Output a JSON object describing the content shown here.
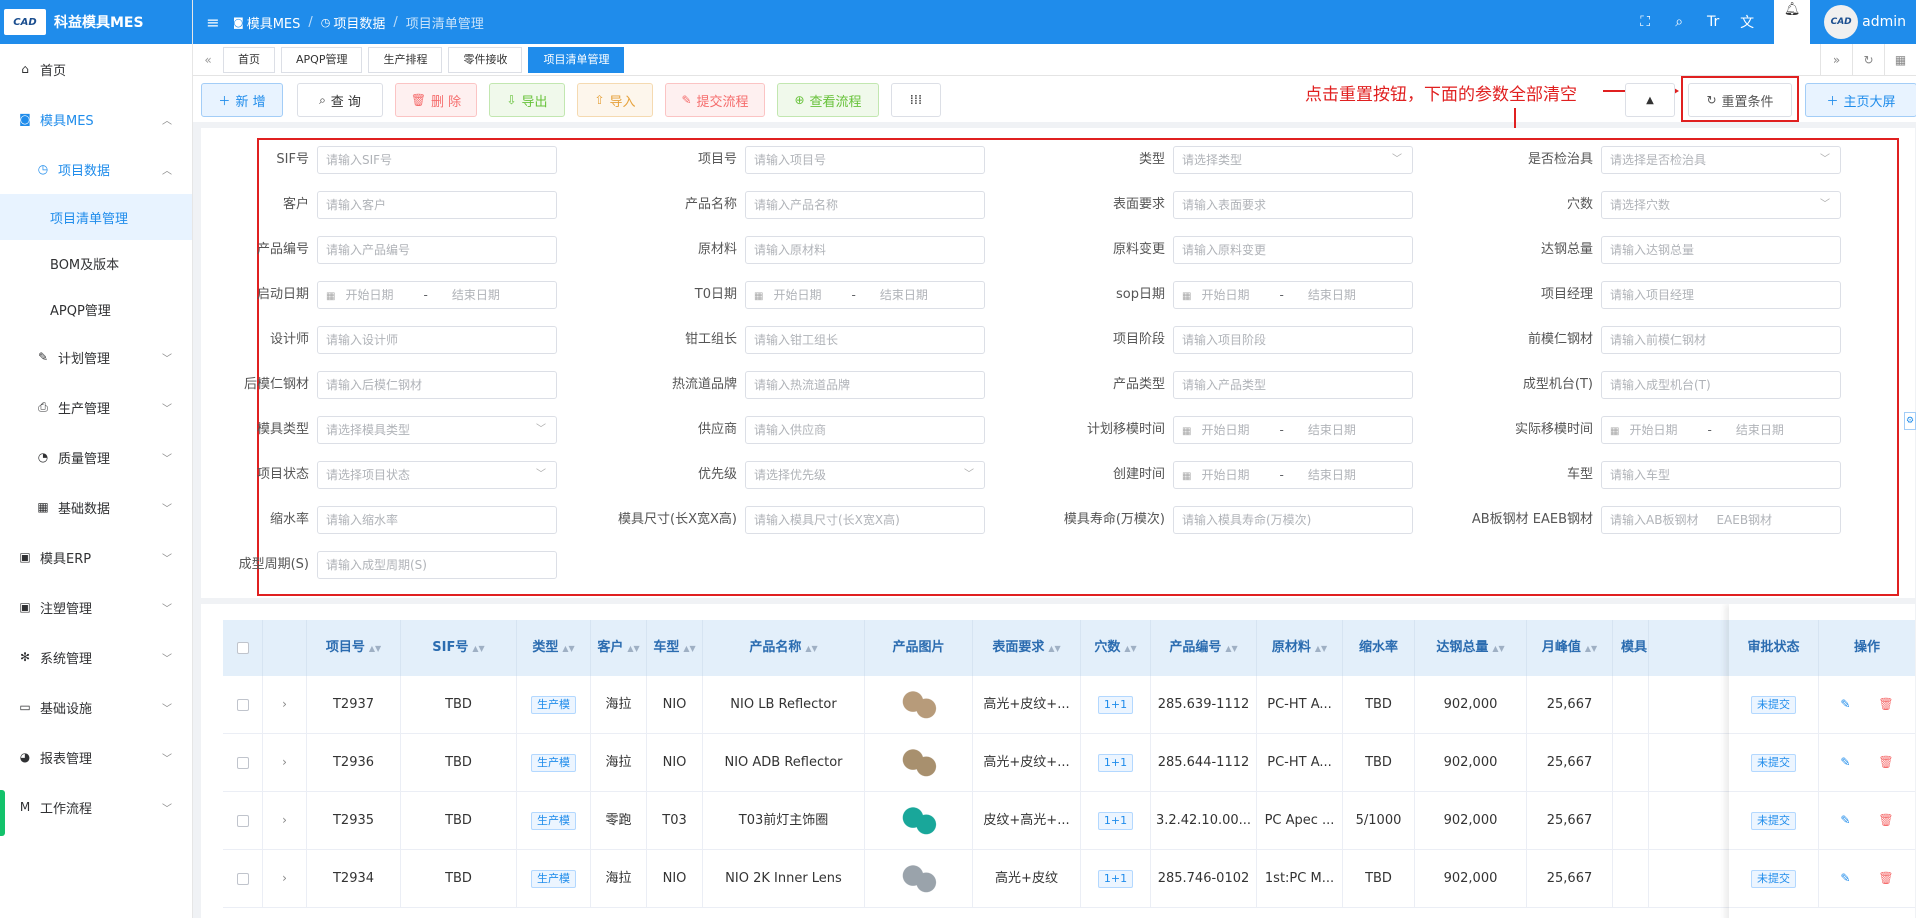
{
  "app": {
    "logo_text": "CAD",
    "title": "科益模具MES",
    "user": "admin",
    "avatar_text": "CAD"
  },
  "breadcrumb": [
    "模具MES",
    "项目数据",
    "项目清单管理"
  ],
  "sidebar": {
    "items": [
      {
        "label": "首页",
        "icon": "home-icon"
      },
      {
        "label": "模具MES",
        "icon": "camera-icon"
      },
      {
        "label": "项目数据",
        "icon": "clock-icon"
      },
      {
        "label": "项目清单管理"
      },
      {
        "label": "BOM及版本"
      },
      {
        "label": "APQP管理"
      },
      {
        "label": "计划管理",
        "icon": "edit-icon"
      },
      {
        "label": "生产管理",
        "icon": "printer-icon"
      },
      {
        "label": "质量管理",
        "icon": "timer-icon"
      },
      {
        "label": "基础数据",
        "icon": "calendar-icon"
      },
      {
        "label": "模具ERP",
        "icon": "bag-icon"
      },
      {
        "label": "注塑管理",
        "icon": "bag-icon"
      },
      {
        "label": "系统管理",
        "icon": "gear-icon"
      },
      {
        "label": "基础设施",
        "icon": "monitor-icon"
      },
      {
        "label": "报表管理",
        "icon": "pie-icon"
      },
      {
        "label": "工作流程",
        "icon": "flow-icon"
      }
    ]
  },
  "tabs": [
    "首页",
    "APQP管理",
    "生产排程",
    "零件接收",
    "项目清单管理"
  ],
  "toolbar": {
    "add": "新 增",
    "query": "查 询",
    "delete": "删 除",
    "export": "导出",
    "import": "导入",
    "submit": "提交流程",
    "view_flow": "查看流程",
    "reset": "重置条件",
    "big_screen": "主页大屏"
  },
  "annotation": "点击重置按钮，下面的参数全部清空",
  "filters": [
    {
      "label": "SIF号",
      "placeholder": "请输入SIF号"
    },
    {
      "label": "项目号",
      "placeholder": "请输入项目号"
    },
    {
      "label": "类型",
      "placeholder": "请选择类型",
      "select": true
    },
    {
      "label": "是否检治具",
      "placeholder": "请选择是否检治具",
      "select": true
    },
    {
      "label": "客户",
      "placeholder": "请输入客户"
    },
    {
      "label": "产品名称",
      "placeholder": "请输入产品名称"
    },
    {
      "label": "表面要求",
      "placeholder": "请输入表面要求"
    },
    {
      "label": "穴数",
      "placeholder": "请选择穴数",
      "select": true
    },
    {
      "label": "产品编号",
      "placeholder": "请输入产品编号"
    },
    {
      "label": "原材料",
      "placeholder": "请输入原材料"
    },
    {
      "label": "原料变更",
      "placeholder": "请输入原料变更"
    },
    {
      "label": "达钢总量",
      "placeholder": "请输入达钢总量"
    },
    {
      "label": "启动日期",
      "range": true,
      "start": "开始日期",
      "end": "结束日期"
    },
    {
      "label": "T0日期",
      "range": true,
      "start": "开始日期",
      "end": "结束日期"
    },
    {
      "label": "sop日期",
      "range": true,
      "start": "开始日期",
      "end": "结束日期"
    },
    {
      "label": "项目经理",
      "placeholder": "请输入项目经理"
    },
    {
      "label": "设计师",
      "placeholder": "请输入设计师"
    },
    {
      "label": "钳工组长",
      "placeholder": "请输入钳工组长"
    },
    {
      "label": "项目阶段",
      "placeholder": "请输入项目阶段"
    },
    {
      "label": "前模仁钢材",
      "placeholder": "请输入前模仁钢材"
    },
    {
      "label": "后模仁钢材",
      "placeholder": "请输入后模仁钢材"
    },
    {
      "label": "热流道品牌",
      "placeholder": "请输入热流道品牌"
    },
    {
      "label": "产品类型",
      "placeholder": "请输入产品类型"
    },
    {
      "label": "成型机台(T)",
      "placeholder": "请输入成型机台(T)"
    },
    {
      "label": "模具类型",
      "placeholder": "请选择模具类型",
      "select": true
    },
    {
      "label": "供应商",
      "placeholder": "请输入供应商"
    },
    {
      "label": "计划移模时间",
      "range": true,
      "start": "开始日期",
      "end": "结束日期"
    },
    {
      "label": "实际移模时间",
      "range": true,
      "start": "开始日期",
      "end": "结束日期"
    },
    {
      "label": "项目状态",
      "placeholder": "请选择项目状态",
      "select": true
    },
    {
      "label": "优先级",
      "placeholder": "请选择优先级",
      "select": true
    },
    {
      "label": "创建时间",
      "range": true,
      "start": "开始日期",
      "end": "结束日期"
    },
    {
      "label": "车型",
      "placeholder": "请输入车型"
    },
    {
      "label": "缩水率",
      "placeholder": "请输入缩水率"
    },
    {
      "label": "模具尺寸(长X宽X高)",
      "placeholder": "请输入模具尺寸(长X宽X高)"
    },
    {
      "label": "模具寿命(万模次)",
      "placeholder": "请输入模具寿命(万模次)"
    },
    {
      "label": "AB板钢材 EAEB钢材",
      "placeholder": "请输入AB板钢材",
      "placeholder2": "EAEB钢材"
    },
    {
      "label": "成型周期(S)",
      "placeholder": "请输入成型周期(S)"
    }
  ],
  "table": {
    "columns": [
      "项目号",
      "SIF号",
      "类型",
      "客户",
      "车型",
      "产品名称",
      "产品图片",
      "表面要求",
      "穴数",
      "产品编号",
      "原材料",
      "缩水率",
      "达钢总量",
      "月峰值",
      "模具",
      "审批状态",
      "操作"
    ],
    "rows": [
      {
        "project": "T2937",
        "sif": "TBD",
        "type": "生产模",
        "customer": "海拉",
        "car": "NIO",
        "name": "NIO LB Reflector",
        "surface": "高光+皮纹+...",
        "cavity": "1+1",
        "code": "285.639-1112",
        "material": "PC-HT A...",
        "shrink": "TBD",
        "total": "902,000",
        "peak": "25,667",
        "status": "未提交",
        "img_color": "#b79b7a"
      },
      {
        "project": "T2936",
        "sif": "TBD",
        "type": "生产模",
        "customer": "海拉",
        "car": "NIO",
        "name": "NIO ADB Reflector",
        "surface": "高光+皮纹+...",
        "cavity": "1+1",
        "code": "285.644-1112",
        "material": "PC-HT A...",
        "shrink": "TBD",
        "total": "902,000",
        "peak": "25,667",
        "status": "未提交",
        "img_color": "#a8906e"
      },
      {
        "project": "T2935",
        "sif": "TBD",
        "type": "生产模",
        "customer": "零跑",
        "car": "T03",
        "name": "T03前灯主饰圈",
        "surface": "皮纹+高光+...",
        "cavity": "1+1",
        "code": "3.2.42.10.00...",
        "material": "PC Apec ...",
        "shrink": "5/1000",
        "total": "902,000",
        "peak": "25,667",
        "status": "未提交",
        "img_color": "#19a79a"
      },
      {
        "project": "T2934",
        "sif": "TBD",
        "type": "生产模",
        "customer": "海拉",
        "car": "NIO",
        "name": "NIO 2K Inner Lens",
        "surface": "高光+皮纹",
        "cavity": "1+1",
        "code": "285.746-0102",
        "material": "1st:PC M...",
        "shrink": "TBD",
        "total": "902,000",
        "peak": "25,667",
        "status": "未提交",
        "img_color": "#9aa3ab"
      }
    ]
  }
}
